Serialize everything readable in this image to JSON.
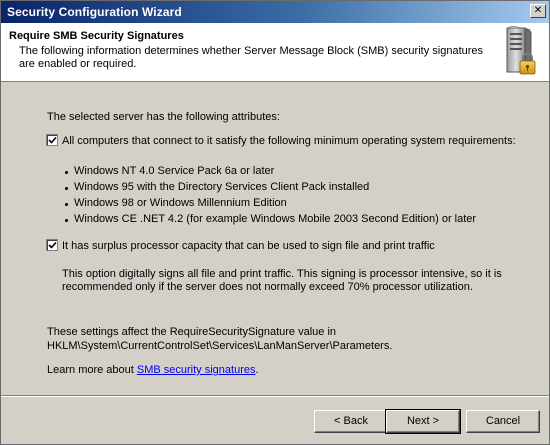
{
  "window": {
    "title": "Security Configuration Wizard",
    "close_glyph": "✕"
  },
  "header": {
    "title": "Require SMB Security Signatures",
    "description": "The following information determines whether Server Message Block (SMB) security signatures are enabled or required.",
    "icon": "server-lock-icon"
  },
  "content": {
    "intro": "The selected server has the following attributes:",
    "option1": {
      "checked": true,
      "label": "All computers that connect to it satisfy the following minimum operating system requirements:"
    },
    "requirements": [
      "Windows NT 4.0 Service Pack 6a or later",
      "Windows 95 with the Directory Services Client Pack installed",
      "Windows 98 or Windows Millennium Edition",
      "Windows CE .NET 4.2 (for example Windows Mobile 2003 Second Edition) or later"
    ],
    "option2": {
      "checked": true,
      "label": "It has surplus processor capacity that can be used to sign file and print traffic"
    },
    "option2_note_line1": "This option digitally signs all file and print traffic. This signing is processor intensive, so it is",
    "option2_note_line2": "recommended only if the server does not normally exceed 70% processor utilization.",
    "settings_line1": "These settings affect the RequireSecuritySignature value in",
    "settings_line2": "HKLM\\System\\CurrentControlSet\\Services\\LanManServer\\Parameters.",
    "learn_prefix": "Learn more about ",
    "learn_link": "SMB security signatures",
    "learn_suffix": "."
  },
  "buttons": {
    "back": "< Back",
    "next": "Next >",
    "cancel": "Cancel"
  }
}
